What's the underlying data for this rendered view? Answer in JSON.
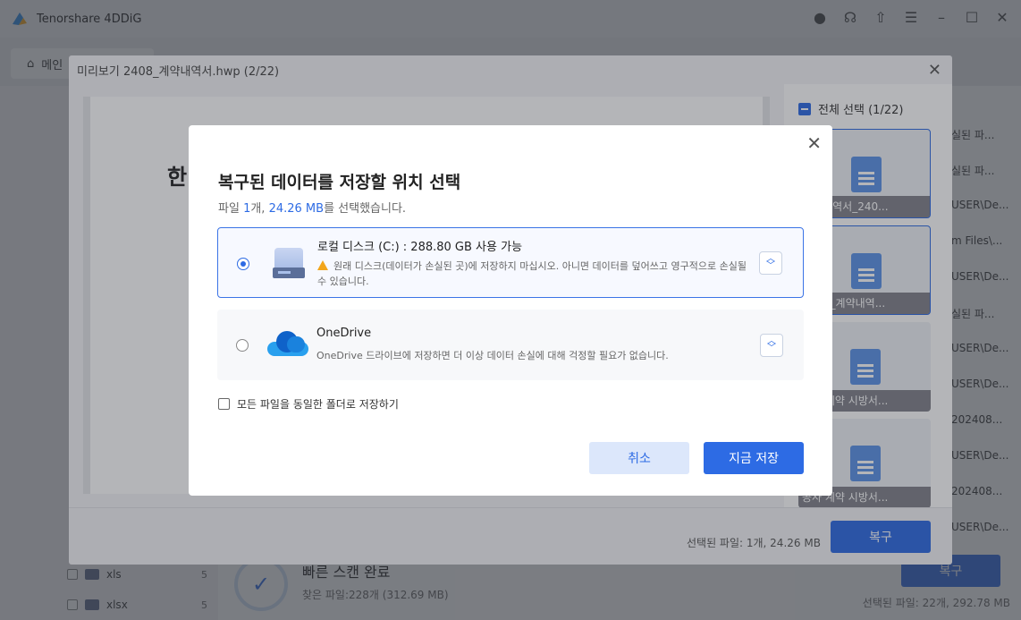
{
  "app": {
    "title": "Tenorshare 4DDiG",
    "home_tab": "메인",
    "scan_title": "빠른 스캔 완료",
    "scan_found": "찾은 파일:228개 (312.69 MB)",
    "recover_label": "복구",
    "selected_status": "선택된 파일: 22개, 292.78 MB",
    "tree": [
      {
        "label": "xls",
        "count": "5"
      },
      {
        "label": "xlsx",
        "count": "5"
      }
    ],
    "path_column": [
      "실된 파...",
      "실된 파...",
      "USER\\De...",
      "m Files\\...",
      "USER\\De...",
      "실된 파...",
      "USER\\De...",
      "USER\\De...",
      "202408...",
      "USER\\De...",
      "202408...",
      "USER\\De..."
    ]
  },
  "preview": {
    "title": "미리보기 2408_계약내역서.hwp (2/22)",
    "doc_heading": "한",
    "select_all": "전체 선택 (1/22)",
    "thumbnails": [
      {
        "caption": "계약내역서_240..."
      },
      {
        "caption": "2408_계약내역..."
      },
      {
        "caption": "공사 계약 시방서..."
      },
      {
        "caption": "공사 계약 시방서..."
      }
    ],
    "selected_status": "선택된 파일: 1개, 24.26 MB",
    "recover_label": "복구"
  },
  "dialog": {
    "title": "복구된 데이터를 저장할 위치 선택",
    "subtitle_prefix": "파일 ",
    "subtitle_count": "1",
    "subtitle_mid": "개, ",
    "subtitle_size": "24.26 MB",
    "subtitle_suffix": "를 선택했습니다.",
    "options": [
      {
        "name": "로컬 디스크 (C:) : 288.80 GB 사용 가능",
        "desc": "원래 디스크(데이터가 손실된 곳)에 저장하지 마십시오. 아니면 데이터를 덮어쓰고 영구적으로 손실될 수 있습니다.",
        "selected": true
      },
      {
        "name": "OneDrive",
        "desc": "OneDrive 드라이브에 저장하면 더 이상 데이터 손실에 대해 걱정할 필요가 없습니다.",
        "selected": false
      }
    ],
    "same_folder_label": "모든 파일을 동일한 폴더로 저장하기",
    "cancel_label": "취소",
    "save_label": "지금 저장"
  },
  "colors": {
    "accent": "#2d6be4",
    "warning": "#f2a51a"
  }
}
